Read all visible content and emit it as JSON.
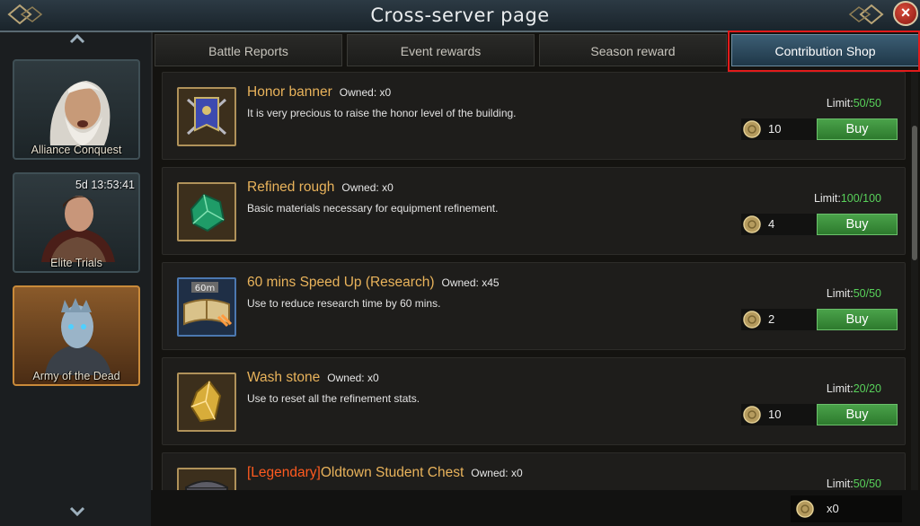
{
  "window": {
    "title": "Cross-server page",
    "close_label": "×"
  },
  "sidebar": {
    "cards": [
      {
        "label": "Alliance Conquest",
        "portrait": "old-man-portrait"
      },
      {
        "label": "Elite Trials",
        "timer": "5d 13:53:41",
        "portrait": "warrior-portrait"
      },
      {
        "label": "Army of the Dead",
        "portrait": "white-walker-portrait",
        "active": true
      }
    ]
  },
  "tabs": [
    {
      "label": "Battle Reports"
    },
    {
      "label": "Event rewards"
    },
    {
      "label": "Season reward"
    },
    {
      "label": "Contribution Shop",
      "active": true
    }
  ],
  "items": [
    {
      "name": "Honor banner",
      "owned": "Owned: x0",
      "desc": "It is very precious to raise the honor level of the building.",
      "limit_label": "Limit:",
      "limit_value": "50/50",
      "price": "10",
      "buy_label": "Buy",
      "icon": "honor-banner-icon"
    },
    {
      "name": "Refined rough",
      "owned": "Owned: x0",
      "desc": "Basic materials necessary for equipment refinement.",
      "limit_label": "Limit:",
      "limit_value": "100/100",
      "price": "4",
      "buy_label": "Buy",
      "icon": "green-gem-icon"
    },
    {
      "name": "60 mins Speed Up (Research)",
      "owned": "Owned: x45",
      "desc": "Use to reduce research time by 60 mins.",
      "limit_label": "Limit:",
      "limit_value": "50/50",
      "price": "2",
      "buy_label": "Buy",
      "icon": "research-book-icon",
      "badge": "60m"
    },
    {
      "name": "Wash stone",
      "owned": "Owned: x0",
      "desc": "Use to reset all the refinement stats.",
      "limit_label": "Limit:",
      "limit_value": "20/20",
      "price": "10",
      "buy_label": "Buy",
      "icon": "yellow-crystal-icon"
    },
    {
      "name_prefix": "[Legendary]",
      "name": "Oldtown Student Chest",
      "owned": "Owned: x0",
      "limit_label": "Limit:",
      "limit_value": "50/50",
      "icon": "chest-icon"
    }
  ],
  "footer": {
    "balance": "x0",
    "icon": "coin-icon"
  },
  "colors": {
    "accent_gold": "#e9b35b",
    "limit_green": "#58d15a",
    "buy_green": "#3d8f3d",
    "highlight_red": "#e21b1b",
    "legendary": "#ff5a1f"
  }
}
